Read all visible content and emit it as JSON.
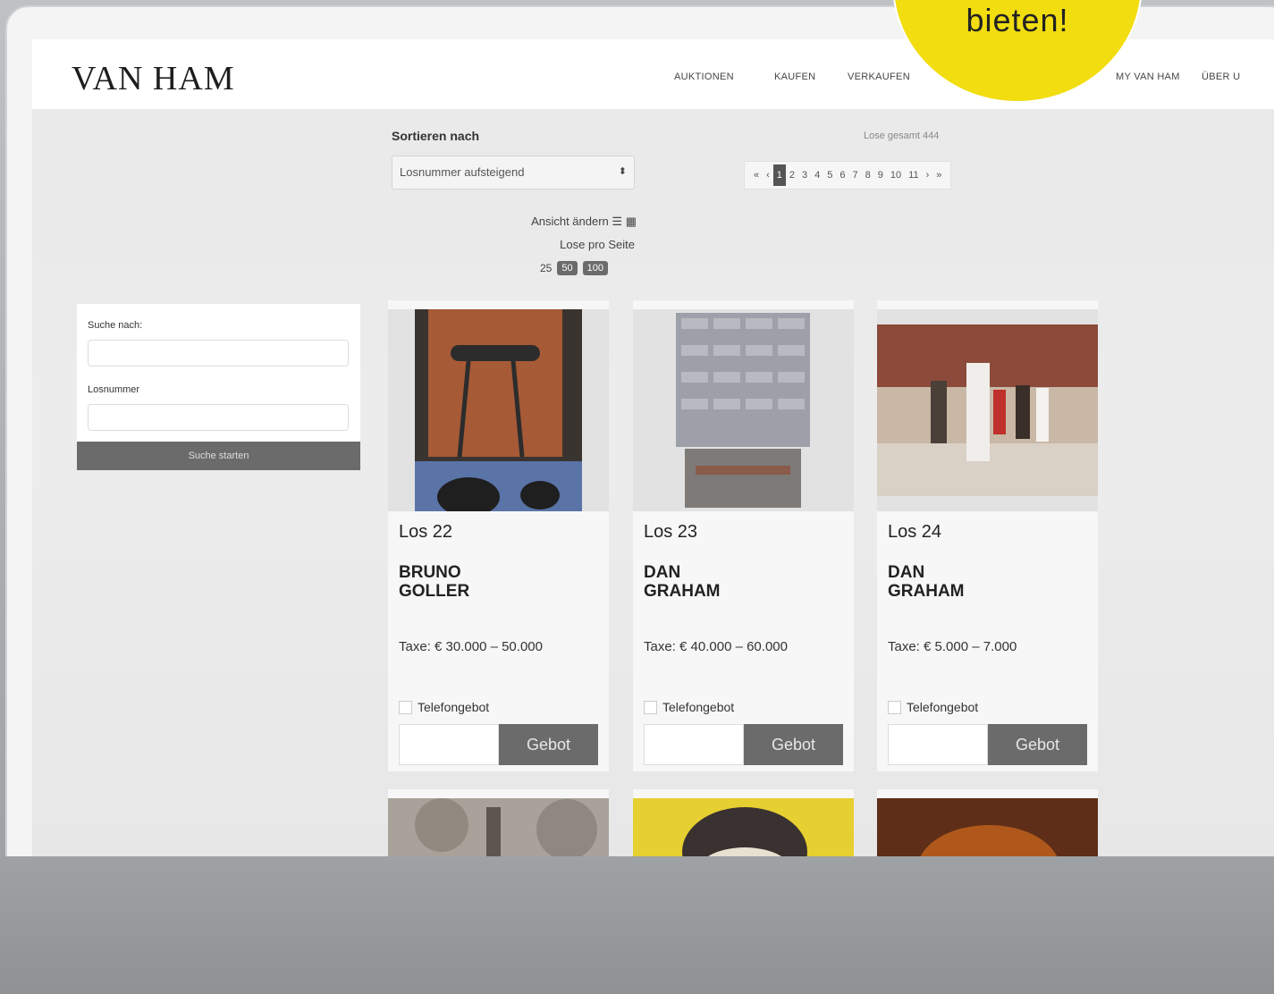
{
  "header": {
    "logo": "VAN HAM",
    "nav": [
      "AUKTIONEN",
      "KAUFEN",
      "VERKAUFEN",
      "MY VAN HAM",
      "ÜBER U"
    ]
  },
  "badge": {
    "text": "bieten!"
  },
  "sort": {
    "label": "Sortieren nach",
    "selected": "Losnummer aufsteigend"
  },
  "lots_total": "Lose gesamt 444",
  "pagination": {
    "first": "«",
    "prev": "‹",
    "pages": [
      "1",
      "2",
      "3",
      "4",
      "5",
      "6",
      "7",
      "8",
      "9",
      "10",
      "11"
    ],
    "next": "›",
    "last": "»"
  },
  "view": {
    "change_label": "Ansicht ändern",
    "per_page_label": "Lose pro Seite",
    "options": [
      "25",
      "50",
      "100"
    ]
  },
  "search": {
    "query_label": "Suche nach:",
    "lot_label": "Losnummer",
    "button": "Suche starten"
  },
  "lots": [
    {
      "lot": "Los 22",
      "artist_first": "BRUNO",
      "artist_last": "GOLLER",
      "estimate": "Taxe: € 30.000 – 50.000",
      "phone_bid": "Telefongebot",
      "bid_button": "Gebot"
    },
    {
      "lot": "Los 23",
      "artist_first": "DAN",
      "artist_last": "GRAHAM",
      "estimate": "Taxe: € 40.000 – 60.000",
      "phone_bid": "Telefongebot",
      "bid_button": "Gebot"
    },
    {
      "lot": "Los 24",
      "artist_first": "DAN",
      "artist_last": "GRAHAM",
      "estimate": "Taxe: € 5.000 – 7.000",
      "phone_bid": "Telefongebot",
      "bid_button": "Gebot"
    }
  ],
  "colors": {
    "badge": "#f2dd10",
    "button": "#6b6b6b"
  }
}
